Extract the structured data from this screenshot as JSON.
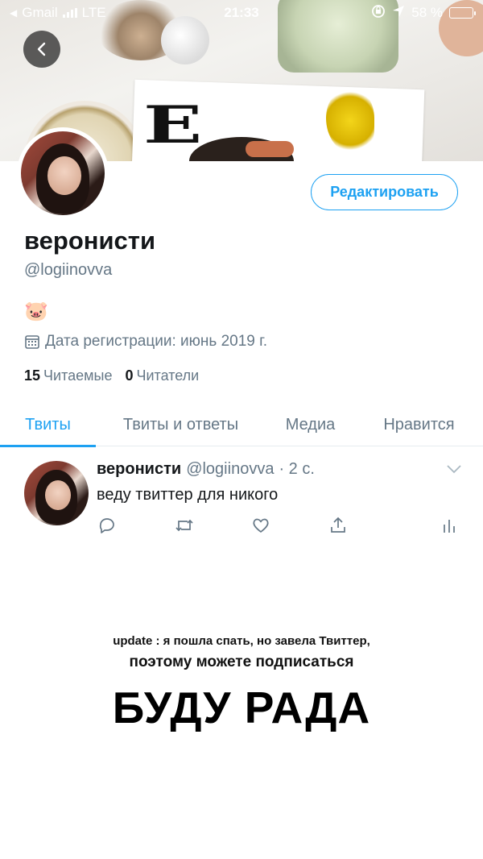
{
  "status_bar": {
    "carrier": "Gmail",
    "network": "LTE",
    "time": "21:33",
    "battery": "58 %",
    "battery_fraction": 0.58,
    "battery_color": "#ffd60a"
  },
  "profile": {
    "name": "веронисти",
    "handle": "@logiinovva",
    "bio": "🐷",
    "joined": "Дата регистрации: июнь 2019 г.",
    "edit_label": "Редактировать",
    "following_count": "15",
    "following_label": "Читаемые",
    "followers_count": "0",
    "followers_label": "Читатели"
  },
  "tabs": [
    {
      "label": "Твиты",
      "active": true
    },
    {
      "label": "Твиты и ответы",
      "active": false
    },
    {
      "label": "Медиа",
      "active": false
    },
    {
      "label": "Нравится",
      "active": false
    }
  ],
  "tweet": {
    "name": "веронисти",
    "handle": "@logiinovva",
    "time": "· 2 с.",
    "text": "веду твиттер для никого"
  },
  "overlay": {
    "line1": "update : я пошла спать, но завела Твиттер,",
    "line2": "поэтому можете подписаться",
    "line3": "БУДУ РАДА"
  },
  "colors": {
    "accent": "#1da1f2",
    "secondary_text": "#657786",
    "primary_text": "#14171a"
  },
  "icons": [
    "back-arrow-icon",
    "calendar-icon",
    "chevron-down-icon",
    "reply-icon",
    "retweet-icon",
    "like-icon",
    "share-icon",
    "analytics-icon",
    "location-arrow-icon",
    "orientation-lock-icon"
  ]
}
